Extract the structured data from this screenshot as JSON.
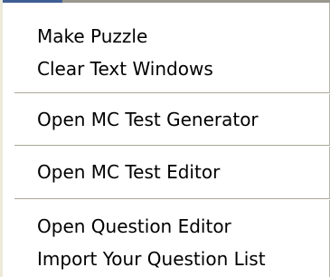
{
  "menu": {
    "items": [
      {
        "label": "Make Puzzle"
      },
      {
        "label": "Clear Text Windows"
      },
      {
        "label": "Open MC Test Generator"
      },
      {
        "label": "Open MC Test Editor"
      },
      {
        "label": "Open Question Editor"
      },
      {
        "label": "Import Your Question List"
      }
    ]
  }
}
